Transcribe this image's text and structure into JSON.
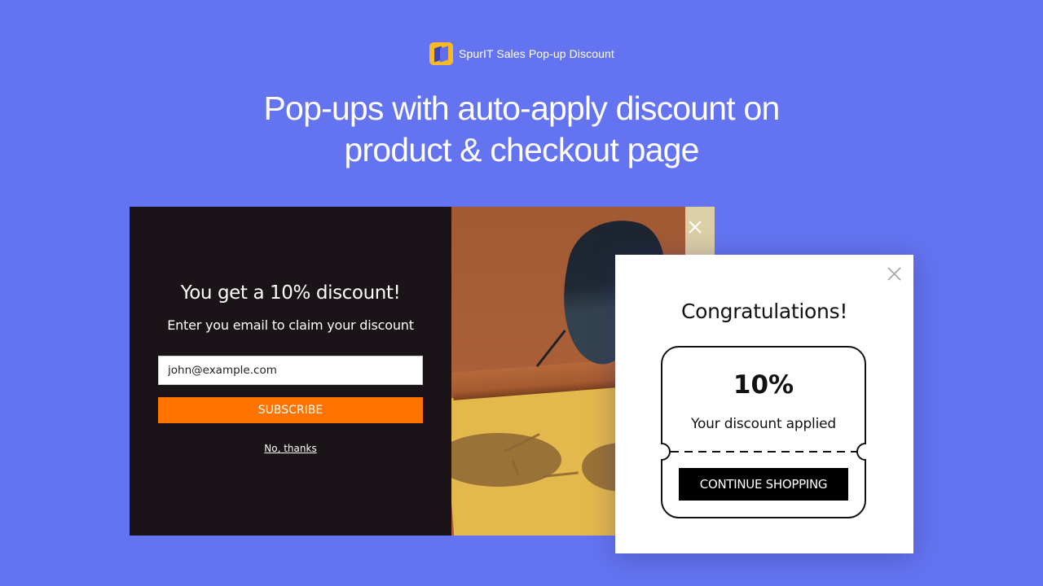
{
  "brand": {
    "name": "SpurIT Sales Pop-up Discount",
    "logo_icon": "spurit-logo-icon",
    "logo_color": "#f7b925"
  },
  "headline": {
    "line1": "Pop-ups with auto-apply discount on",
    "line2": "product & checkout page"
  },
  "subscribe_popup": {
    "title": "You get a 10% discount!",
    "subtitle": "Enter you email to claim your discount",
    "email_value": "john@example.com",
    "email_placeholder": "john@example.com",
    "subscribe_label": "SUBSCRIBE",
    "decline_label": "No, thanks",
    "close_icon": "close-icon",
    "colors": {
      "background": "#1a1418",
      "button": "#ff7300"
    }
  },
  "success_popup": {
    "title": "Congratulations!",
    "discount": "10%",
    "caption": "Your discount applied",
    "continue_label": "CONTINUE SHOPPING",
    "close_icon": "close-icon"
  },
  "colors": {
    "page_background": "#6474f0"
  }
}
